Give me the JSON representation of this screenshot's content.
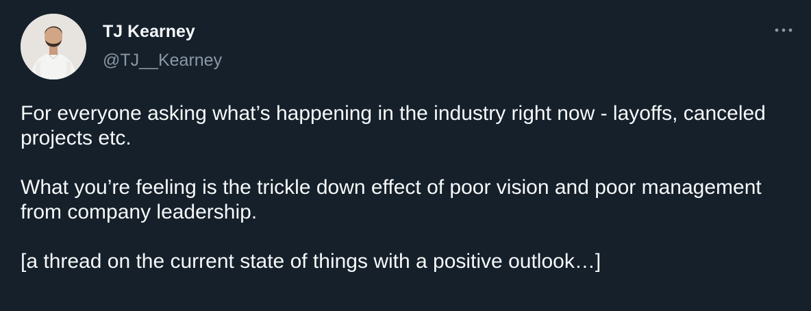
{
  "author": {
    "display_name": "TJ Kearney",
    "handle": "@TJ__Kearney"
  },
  "icons": {
    "avatar": "profile-photo",
    "more": "more-options-ellipsis-icon"
  },
  "tweet": {
    "paragraphs": [
      "For everyone asking what’s happening in the industry right now - layoffs, canceled projects etc.",
      "What you’re feeling is the trickle down effect of poor vision and poor management from company leadership.",
      "[a thread on the current state of things with a positive outlook…]"
    ]
  },
  "colors": {
    "background": "#15202b",
    "primary_text": "#f7f9f9",
    "secondary_text": "#8b98a5"
  }
}
